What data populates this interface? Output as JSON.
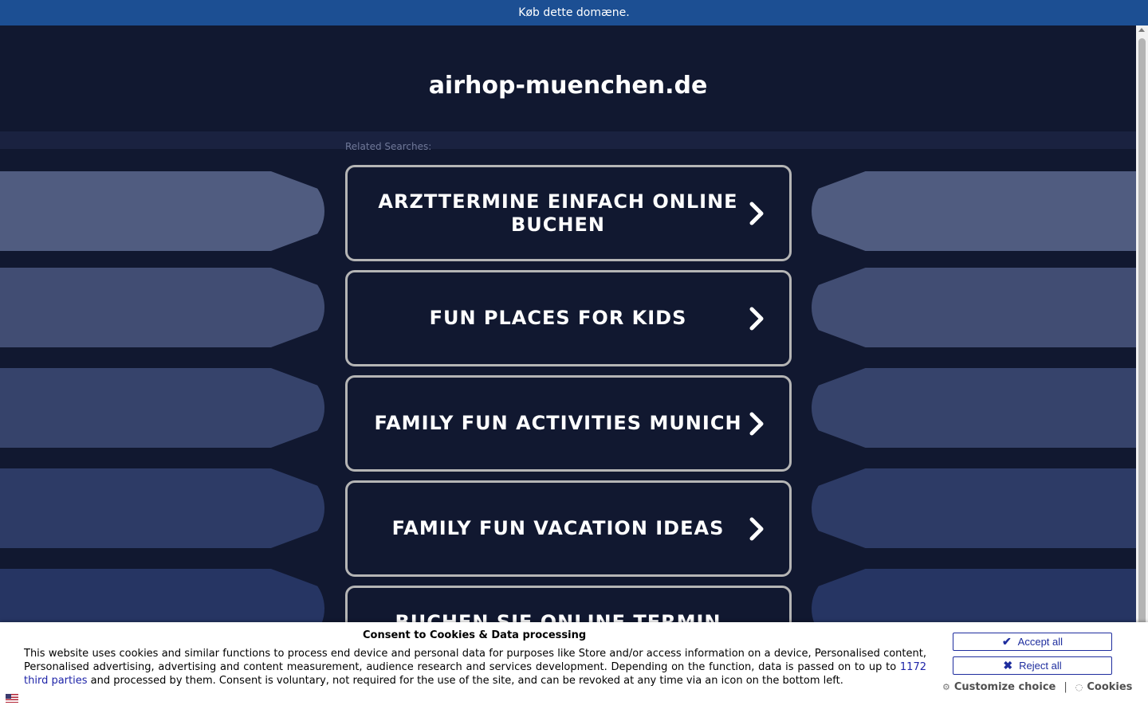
{
  "topbar": {
    "label": "Køb dette domæne."
  },
  "domain": {
    "title": "airhop-muenchen.de"
  },
  "related": {
    "label": "Related Searches:",
    "items": [
      {
        "label": "ARZTTERMINE EINFACH ONLINE BUCHEN"
      },
      {
        "label": "FUN PLACES FOR KIDS"
      },
      {
        "label": "FAMILY FUN ACTIVITIES MUNICH"
      },
      {
        "label": "FAMILY FUN VACATION IDEAS"
      },
      {
        "label": "BUCHEN SIE ONLINE TERMIN MIT"
      }
    ]
  },
  "consent": {
    "title": "Consent to Cookies & Data processing",
    "text_before": "This website uses cookies and similar functions to process end device and personal data for purposes like Store and/or access information on a device, Personalised content, Personalised advertising, advertising and content measurement, audience research and services development. Depending on the function, data is passed on to up to ",
    "third_parties_link": "1172 third parties",
    "text_after": " and processed by them. Consent is voluntary, not required for the use of the site, and can be revoked at any time via an icon on the bottom left.",
    "accept_label": "Accept all",
    "reject_label": "Reject all",
    "customize_label": "Customize choice",
    "separator": "|",
    "cookies_label": "Cookies"
  },
  "colors": {
    "topbar": "#1c4f93",
    "background": "#111830",
    "button_border": "#1e2d9e"
  }
}
